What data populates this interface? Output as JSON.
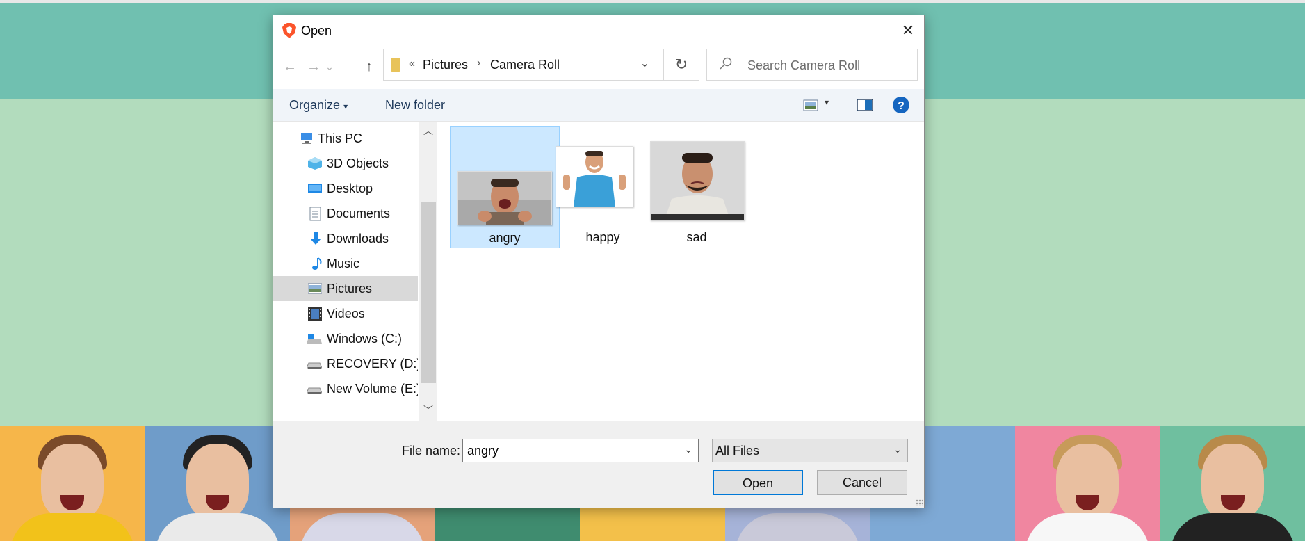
{
  "dialog": {
    "title": "Open",
    "close_glyph": "✕"
  },
  "nav": {
    "back_glyph": "←",
    "forward_glyph": "→",
    "recent_glyph": "⌄",
    "up_glyph": "↑",
    "breadcrumb_sep0": "«",
    "breadcrumb": [
      "Pictures",
      "Camera Roll"
    ],
    "breadcrumb_sep": "›",
    "address_dropdown_glyph": "⌄",
    "refresh_glyph": "↻",
    "search_placeholder": "Search Camera Roll"
  },
  "toolbar": {
    "organize_label": "Organize",
    "organize_caret": "▾",
    "new_folder_label": "New folder",
    "view_caret": "▾",
    "help_glyph": "?"
  },
  "sidebar": {
    "items": [
      {
        "label": "This PC",
        "icon": "computer-icon",
        "selected": false
      },
      {
        "label": "3D Objects",
        "icon": "3d-objects-icon",
        "selected": false
      },
      {
        "label": "Desktop",
        "icon": "desktop-icon",
        "selected": false
      },
      {
        "label": "Documents",
        "icon": "documents-icon",
        "selected": false
      },
      {
        "label": "Downloads",
        "icon": "downloads-icon",
        "selected": false
      },
      {
        "label": "Music",
        "icon": "music-icon",
        "selected": false
      },
      {
        "label": "Pictures",
        "icon": "pictures-icon",
        "selected": true
      },
      {
        "label": "Videos",
        "icon": "videos-icon",
        "selected": false
      },
      {
        "label": "Windows (C:)",
        "icon": "windows-drive-icon",
        "selected": false
      },
      {
        "label": "RECOVERY (D:)",
        "icon": "drive-icon",
        "selected": false
      },
      {
        "label": "New Volume (E:)",
        "icon": "drive-icon",
        "selected": false
      }
    ],
    "scroll_up_glyph": "︿",
    "scroll_down_glyph": "﹀"
  },
  "files": [
    {
      "name": "angry",
      "selected": true
    },
    {
      "name": "happy",
      "selected": false
    },
    {
      "name": "sad",
      "selected": false
    }
  ],
  "footer": {
    "file_name_label": "File name:",
    "file_name_value": "angry",
    "file_name_dropdown_glyph": "⌄",
    "file_type_value": "All Files",
    "file_type_dropdown_glyph": "⌄",
    "open_label": "Open",
    "cancel_label": "Cancel"
  },
  "colors": {
    "accent": "#0078d7",
    "selection_bg": "#cce8ff",
    "page_top": "#70c0b0",
    "page_mid": "#b2dcbd"
  }
}
